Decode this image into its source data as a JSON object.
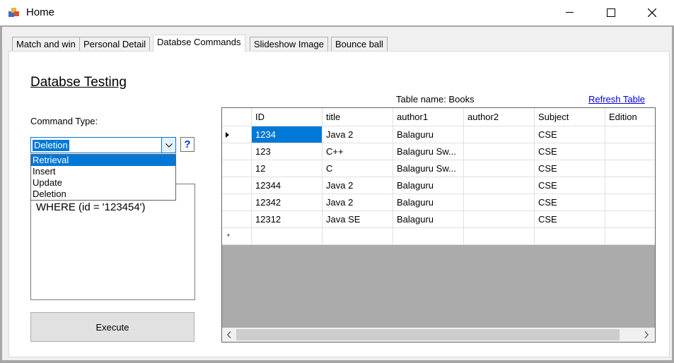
{
  "window": {
    "title": "Home"
  },
  "tabs": [
    {
      "label": "Match and win"
    },
    {
      "label": "Personal Detail"
    },
    {
      "label": "Databse Commands"
    },
    {
      "label": "Slideshow Image"
    },
    {
      "label": "Bounce ball"
    }
  ],
  "active_tab": "Databse Commands",
  "left": {
    "heading": "Databse Testing",
    "command_type_label": "Command Type:",
    "combo_value": "Deletion",
    "help_label": "?",
    "options": [
      "Retrieval",
      "Insert",
      "Update",
      "Deletion"
    ],
    "highlighted_option": "Retrieval",
    "query_text": "WHERE (id = '123454')",
    "execute_label": "Execute"
  },
  "right": {
    "table_name": "Table name: Books",
    "refresh_label": "Refresh Table"
  },
  "grid": {
    "columns": [
      "ID",
      "title",
      "author1",
      "author2",
      "Subject",
      "Edition"
    ],
    "rows": [
      [
        "1234",
        "Java 2",
        "Balaguru",
        "",
        "CSE",
        ""
      ],
      [
        "123",
        "C++",
        "Balaguru Sw...",
        "",
        "CSE",
        ""
      ],
      [
        "12",
        "C",
        "Balaguru Sw...",
        "",
        "CSE",
        ""
      ],
      [
        "12344",
        "Java 2",
        "Balaguru",
        "",
        "CSE",
        ""
      ],
      [
        "12342",
        "Java 2",
        "Balaguru",
        "",
        "CSE",
        ""
      ],
      [
        "12312",
        "Java SE",
        "Balaguru",
        "",
        "CSE",
        ""
      ]
    ],
    "new_row_marker": "*"
  },
  "colors": {
    "accent": "#0078d7",
    "link": "#0000ee"
  }
}
